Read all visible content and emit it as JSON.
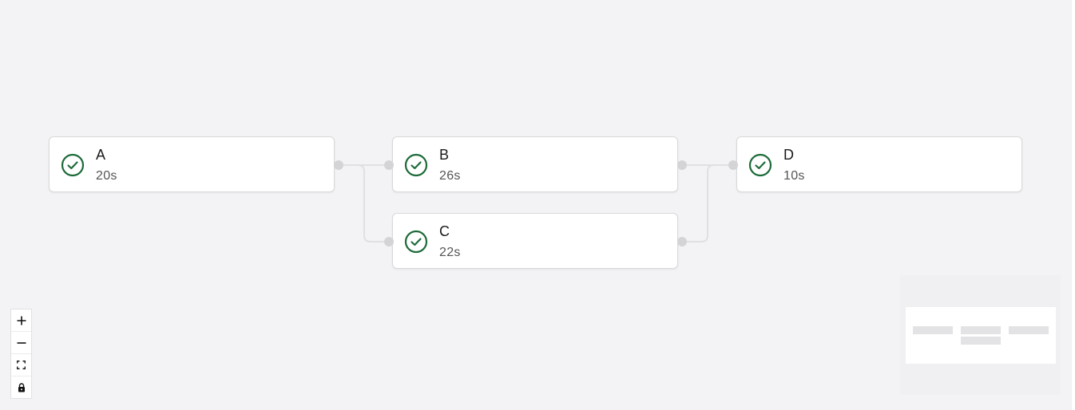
{
  "graph": {
    "nodes": [
      {
        "id": "A",
        "name": "A",
        "duration": "20s",
        "status": "success",
        "status_icon": "check-circle-icon"
      },
      {
        "id": "B",
        "name": "B",
        "duration": "26s",
        "status": "success",
        "status_icon": "check-circle-icon"
      },
      {
        "id": "C",
        "name": "C",
        "duration": "22s",
        "status": "success",
        "status_icon": "check-circle-icon"
      },
      {
        "id": "D",
        "name": "D",
        "duration": "10s",
        "status": "success",
        "status_icon": "check-circle-icon"
      }
    ],
    "edges": [
      {
        "from": "A",
        "to": "B"
      },
      {
        "from": "A",
        "to": "C"
      },
      {
        "from": "B",
        "to": "D"
      },
      {
        "from": "C",
        "to": "D"
      }
    ]
  },
  "controls": [
    {
      "name": "zoom-in-button",
      "icon": "plus-icon"
    },
    {
      "name": "zoom-out-button",
      "icon": "minus-icon"
    },
    {
      "name": "fit-view-button",
      "icon": "fit-view-icon"
    },
    {
      "name": "lock-button",
      "icon": "lock-icon"
    }
  ],
  "minimap": {
    "visible": true
  },
  "colors": {
    "background": "#f3f2f4",
    "node_border": "#d9d7db",
    "success": "#1e6b3a",
    "edge": "#e0dfe2",
    "handle": "#d4d3d6"
  }
}
